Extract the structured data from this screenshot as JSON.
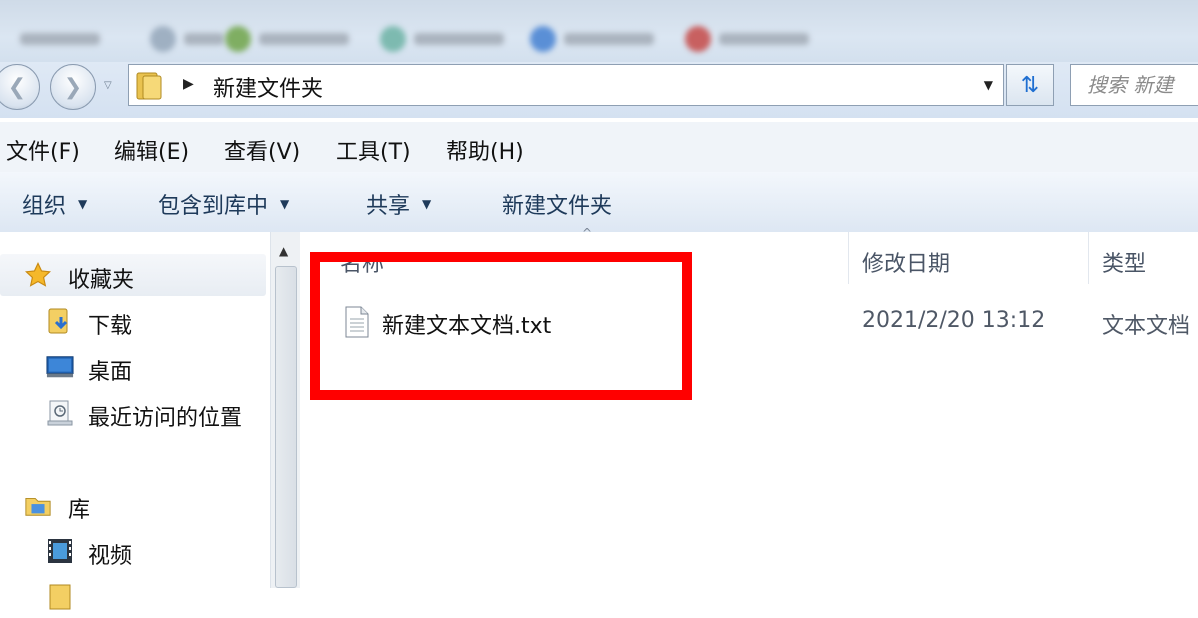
{
  "address_bar": {
    "path": "新建文件夹",
    "search_placeholder": "搜索 新建"
  },
  "menu": [
    "文件(F)",
    "编辑(E)",
    "查看(V)",
    "工具(T)",
    "帮助(H)"
  ],
  "commands": {
    "organize": "组织",
    "include_in_library": "包含到库中",
    "share": "共享",
    "new_folder": "新建文件夹"
  },
  "nav": {
    "favorites": "收藏夹",
    "downloads": "下载",
    "desktop": "桌面",
    "recent": "最近访问的位置",
    "libraries": "库",
    "videos": "视频"
  },
  "columns": {
    "name": "名称",
    "modified": "修改日期",
    "type": "类型"
  },
  "files": [
    {
      "name": "新建文本文档.txt",
      "modified": "2021/2/20 13:12",
      "type": "文本文档"
    }
  ],
  "icons": {
    "back": "back-arrow-icon",
    "forward": "forward-arrow-icon",
    "refresh": "refresh-icon",
    "star": "star-icon",
    "file": "text-file-icon"
  },
  "colors": {
    "highlight": "#ff0000",
    "nav_bg": "#dde7f3"
  }
}
